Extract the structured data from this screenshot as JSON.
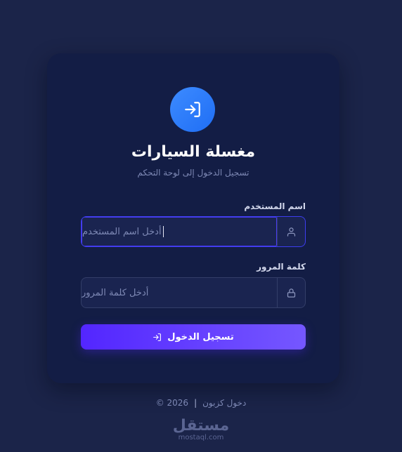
{
  "app": {
    "title": "مغسلة السيارات",
    "subtitle": "تسجيل الدخول إلى لوحة التحكم"
  },
  "form": {
    "username": {
      "label": "اسم المستخدم",
      "placeholder": "أدخل اسم المستخدم",
      "value": "",
      "icon": "user-icon",
      "focused": true
    },
    "password": {
      "label": "كلمة المرور",
      "placeholder": "أدخل كلمة المرور",
      "value": "",
      "icon": "lock-icon"
    },
    "submit": {
      "label": "تسجيل الدخول",
      "icon": "login-arrow-icon"
    }
  },
  "footer": {
    "brand": "دخول كزبون",
    "separator": "|",
    "copyright": "© 2026"
  },
  "watermark": {
    "arabic": "مستقل",
    "latin": "mostaql.com"
  },
  "colors": {
    "background": "#1b2449",
    "card": "#131d45",
    "accent_start": "#5326ff",
    "accent_end": "#7557ff",
    "logo": "#2a7bff"
  }
}
